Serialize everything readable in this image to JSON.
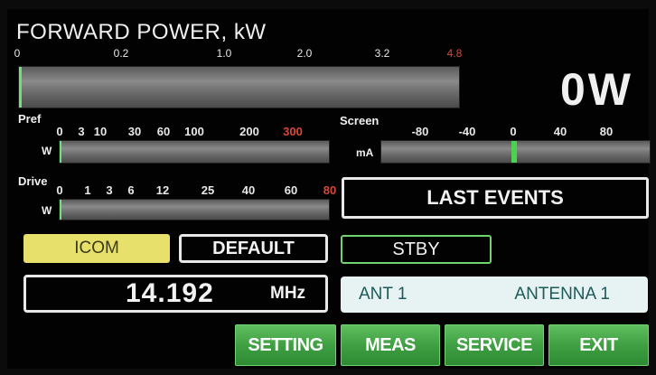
{
  "forward_power": {
    "title": "FORWARD POWER, kW",
    "ticks": [
      "0",
      "0.2",
      "1.0",
      "2.0",
      "3.2",
      "4.8"
    ],
    "readout": "0W",
    "level": 0.0
  },
  "pref": {
    "label": "Pref",
    "unit": "W",
    "ticks": [
      "0",
      "3",
      "10",
      "30",
      "60",
      "100",
      "200",
      "300"
    ],
    "level": 0.0
  },
  "drive": {
    "label": "Drive",
    "unit": "W",
    "ticks": [
      "0",
      "1",
      "3",
      "6",
      "12",
      "25",
      "40",
      "60",
      "80"
    ],
    "level": 0.0
  },
  "screen": {
    "label": "Screen",
    "unit": "mA",
    "ticks": [
      "-80",
      "-40",
      "0",
      "40",
      "80"
    ],
    "value": 0
  },
  "buttons": {
    "last_events": "LAST EVENTS",
    "icom": "ICOM",
    "default": "DEFAULT",
    "stby": "STBY",
    "setting": "SETTING",
    "meas": "MEAS",
    "service": "SERVICE",
    "exit": "EXIT"
  },
  "frequency": {
    "value": "14.192",
    "unit": "MHz"
  },
  "antenna": {
    "port": "ANT 1",
    "name": "ANTENNA 1"
  },
  "colors": {
    "accent_green": "#4cd24e",
    "button_green": "#3f9f42",
    "icom_yellow": "#e7e06a",
    "antenna_bg": "#e6f3f2",
    "limit_red": "#d9473b"
  }
}
